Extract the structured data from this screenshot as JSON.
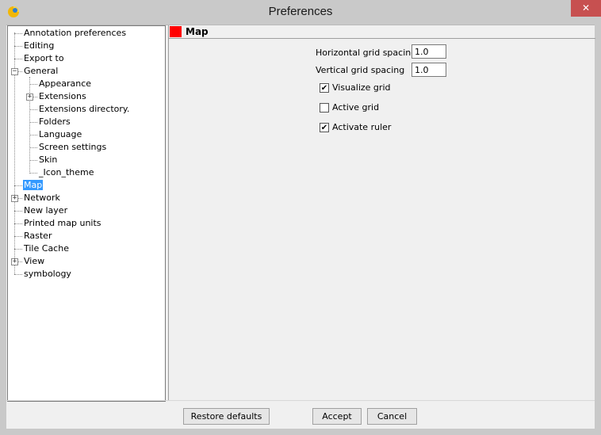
{
  "window": {
    "title": "Preferences",
    "close_glyph": "✕",
    "app_icon": "gvsig-logo-icon"
  },
  "tree": {
    "items": [
      {
        "label": "Annotation preferences",
        "level": 0,
        "expandable": false
      },
      {
        "label": "Editing",
        "level": 0,
        "expandable": false
      },
      {
        "label": "Export to",
        "level": 0,
        "expandable": false
      },
      {
        "label": "General",
        "level": 0,
        "expandable": true,
        "expanded": true
      },
      {
        "label": "Appearance",
        "level": 1,
        "expandable": false
      },
      {
        "label": "Extensions",
        "level": 1,
        "expandable": true,
        "expanded": false
      },
      {
        "label": "Extensions directory.",
        "level": 1,
        "expandable": false
      },
      {
        "label": "Folders",
        "level": 1,
        "expandable": false
      },
      {
        "label": "Language",
        "level": 1,
        "expandable": false
      },
      {
        "label": "Screen settings",
        "level": 1,
        "expandable": false
      },
      {
        "label": "Skin",
        "level": 1,
        "expandable": false
      },
      {
        "label": "_Icon_theme",
        "level": 1,
        "expandable": false
      },
      {
        "label": "Map",
        "level": 0,
        "expandable": false,
        "selected": true
      },
      {
        "label": "Network",
        "level": 0,
        "expandable": true,
        "expanded": false
      },
      {
        "label": "New layer",
        "level": 0,
        "expandable": false
      },
      {
        "label": "Printed map units",
        "level": 0,
        "expandable": false
      },
      {
        "label": "Raster",
        "level": 0,
        "expandable": false
      },
      {
        "label": "Tile Cache",
        "level": 0,
        "expandable": false
      },
      {
        "label": "View",
        "level": 0,
        "expandable": true,
        "expanded": false
      },
      {
        "label": "symbology",
        "level": 0,
        "expandable": false
      }
    ],
    "expander_collapsed": "+",
    "expander_expanded": "−"
  },
  "panel": {
    "title": "Map",
    "marker_color": "#ff0000",
    "fields": {
      "horizontal_grid_spacing": {
        "label": "Horizontal grid spacing",
        "value": "1.0"
      },
      "vertical_grid_spacing": {
        "label": "Vertical grid spacing",
        "value": "1.0"
      }
    },
    "checkboxes": {
      "visualize_grid": {
        "label": "Visualize grid",
        "checked": true
      },
      "active_grid": {
        "label": "Active grid",
        "checked": false
      },
      "activate_ruler": {
        "label": "Activate ruler",
        "checked": true
      }
    }
  },
  "buttons": {
    "restore_defaults": "Restore defaults",
    "accept": "Accept",
    "cancel": "Cancel"
  },
  "colors": {
    "selection": "#3399ff",
    "close_button": "#c75050"
  }
}
